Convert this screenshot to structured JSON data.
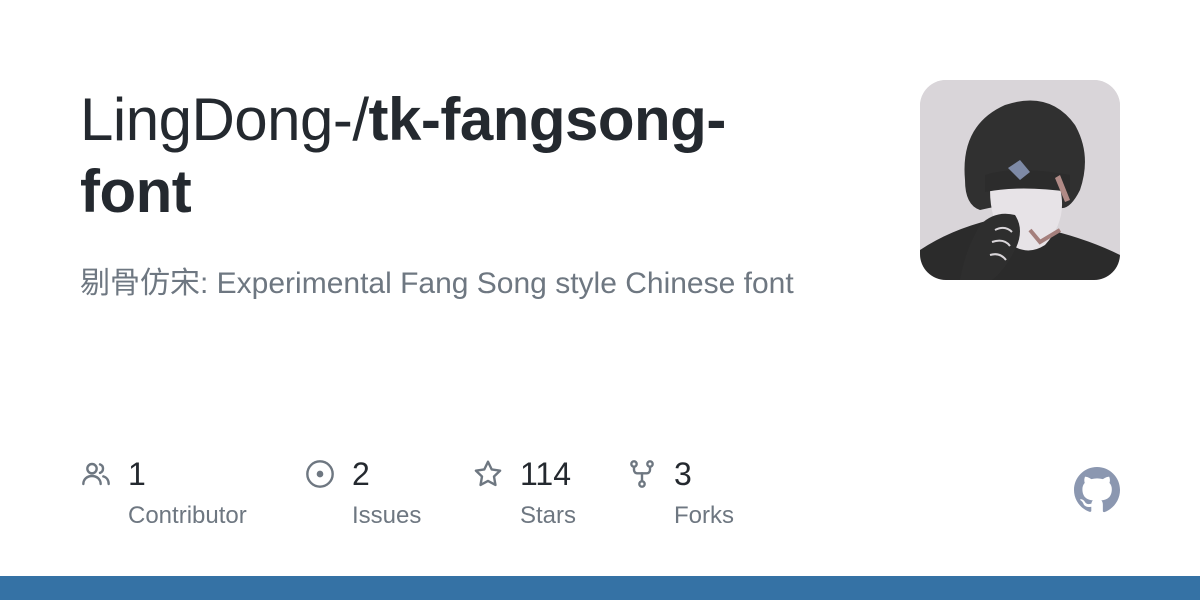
{
  "repo": {
    "owner": "LingDong-/",
    "name_line1": "tk-fangsong-",
    "name_line2": "font",
    "description": "剔骨仿宋: Experimental Fang Song style Chinese font"
  },
  "stats": [
    {
      "icon": "people-icon",
      "count": "1",
      "label": "Contributor"
    },
    {
      "icon": "issue-opened-icon",
      "count": "2",
      "label": "Issues"
    },
    {
      "icon": "star-icon",
      "count": "114",
      "label": "Stars"
    },
    {
      "icon": "repo-forked-icon",
      "count": "3",
      "label": "Forks"
    }
  ],
  "colors": {
    "title": "#24292f",
    "muted": "#6e7781",
    "language_bar": "#3572a5",
    "logo": "#8b97b0"
  }
}
